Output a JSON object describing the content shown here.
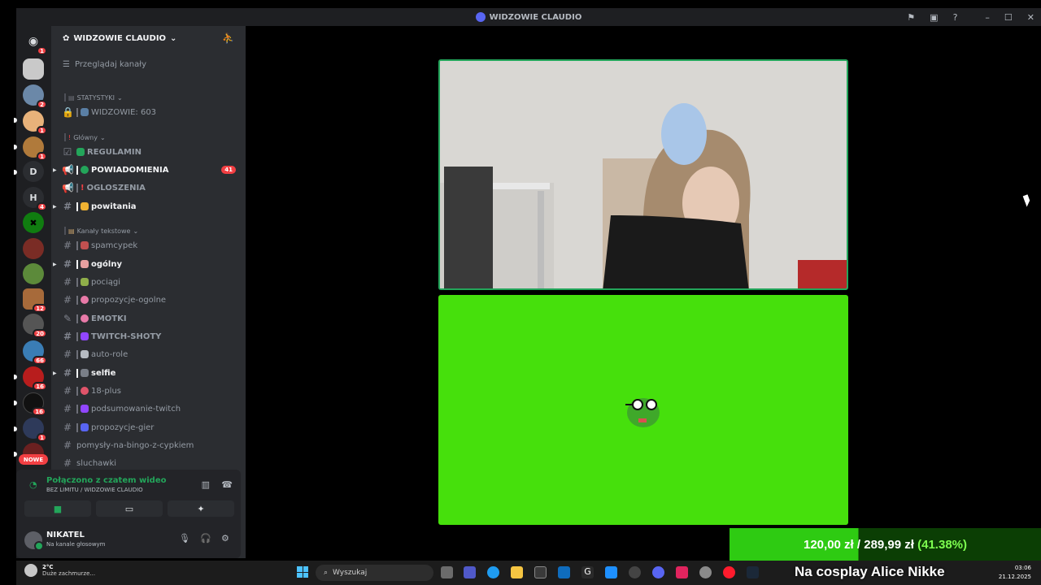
{
  "window": {
    "title": "WIDZOWIE CLAUDIO"
  },
  "rail": {
    "badges": [
      "1",
      "2",
      "1",
      "1",
      "4",
      "12",
      "20",
      "66",
      "16",
      "16",
      "1"
    ],
    "letters": [
      "D",
      "H"
    ],
    "new_label": "NOWE"
  },
  "server": {
    "name": "WIDZOWIE CLAUDIO",
    "browse_label": "Przeglądaj kanały",
    "categories": [
      "STATYSTYKI",
      "Główny",
      "Kanały tekstowe"
    ],
    "stats_channel": "WIDZOWIE: 603",
    "channels": [
      {
        "name": "REGULAMIN"
      },
      {
        "name": "POWIADOMIENIA",
        "mention": "41"
      },
      {
        "name": "OGLOSZENIA"
      },
      {
        "name": "powitania"
      },
      {
        "name": "spamcypek"
      },
      {
        "name": "ogólny"
      },
      {
        "name": "pociągi"
      },
      {
        "name": "propozycje-ogolne"
      },
      {
        "name": "EMOTKI"
      },
      {
        "name": "TWITCH-SHOTY"
      },
      {
        "name": "auto-role"
      },
      {
        "name": "selfie"
      },
      {
        "name": "18-plus"
      },
      {
        "name": "podsumowanie-twitch"
      },
      {
        "name": "propozycje-gier"
      },
      {
        "name": "pomysły-na-bingo-z-cypkiem"
      },
      {
        "name": "sluchawki"
      }
    ]
  },
  "voice": {
    "status": "Połączono z czatem wideo",
    "channel": "BEZ LIMITU / WIDZOWIE CLAUDIO"
  },
  "user": {
    "name": "NIKATEL",
    "status": "Na kanale głosowym"
  },
  "overlay": {
    "goal_current": "120,00 zł",
    "goal_sep": "/",
    "goal_target": "289,99 zł",
    "goal_percent": "(41.38%)",
    "goal_progress": 0.4138,
    "ticker": "Na cosplay Alice Nikke"
  },
  "taskbar": {
    "weather_temp": "2°C",
    "weather_desc": "Duże zachmurze...",
    "search_placeholder": "Wyszukaj",
    "time": "03:06",
    "date": "21.12.2025"
  },
  "colors": {
    "accent_green": "#23a55a",
    "greenscreen": "#46e00c",
    "mention_red": "#f23f43"
  }
}
